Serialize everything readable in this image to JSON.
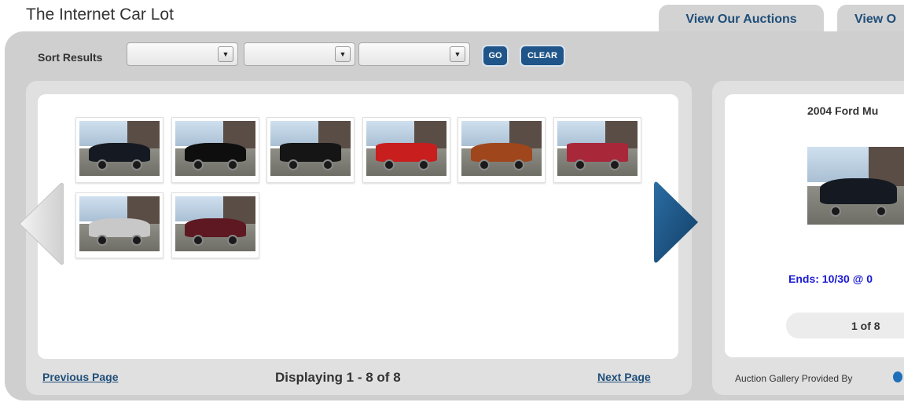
{
  "header": {
    "site_title": "The Internet Car Lot"
  },
  "tabs": [
    {
      "label": "View Our Auctions"
    },
    {
      "label": "View O"
    }
  ],
  "toolbar": {
    "sort_label": "Sort Results",
    "selects": [
      {
        "value": ""
      },
      {
        "value": ""
      },
      {
        "value": ""
      }
    ],
    "go_label": "GO",
    "clear_label": "CLEAR"
  },
  "gallery": {
    "thumbnails": [
      {
        "car_color": "#151a22",
        "body": "sedan"
      },
      {
        "car_color": "#0e0e0e",
        "body": "coupe"
      },
      {
        "car_color": "#151515",
        "body": "convertible"
      },
      {
        "car_color": "#c81e1e",
        "body": "convertible"
      },
      {
        "car_color": "#a0461c",
        "body": "coupe"
      },
      {
        "car_color": "#a8283a",
        "body": "truck"
      },
      {
        "car_color": "#c8c8c8",
        "body": "sedan"
      },
      {
        "car_color": "#5e1822",
        "body": "sedan"
      }
    ],
    "previous_label": "Previous Page",
    "next_label": "Next Page",
    "display_info": "Displaying 1 - 8 of 8",
    "prev_icon": "chevron-left-icon",
    "next_icon": "chevron-right-icon"
  },
  "featured": {
    "title": "2004 Ford Mu",
    "ends": "Ends: 10/30 @ 0",
    "pager": "1 of 8",
    "photo_car_color": "#151a22"
  },
  "footer": {
    "provided_by": "Auction Gallery Provided By"
  },
  "colors": {
    "accent": "#1f4e79",
    "button": "#1f5588",
    "frame": "#cfcfcf",
    "ends_text": "#1a1ad0"
  }
}
